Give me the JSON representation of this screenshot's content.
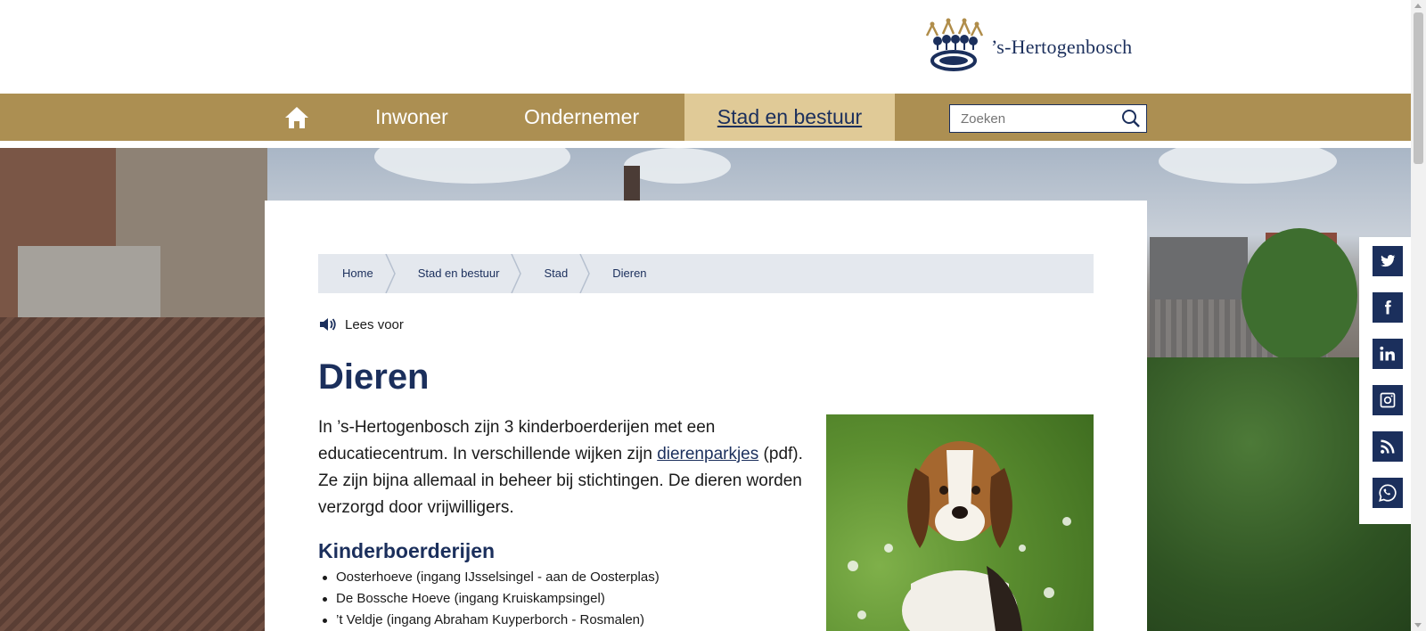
{
  "header": {
    "logo_text": "’s-Hertogenbosch"
  },
  "nav": {
    "home_icon": "home-icon",
    "items": [
      {
        "label": "Inwoner"
      },
      {
        "label": "Ondernemer"
      },
      {
        "label": "Stad en bestuur",
        "active": true
      }
    ],
    "search_placeholder": "Zoeken",
    "accent_color": "#ac8f52",
    "active_color": "#e0ca97"
  },
  "breadcrumb": [
    "Home",
    "Stad en bestuur",
    "Stad",
    "Dieren"
  ],
  "lees_voor": "Lees voor",
  "page": {
    "title": "Dieren",
    "intro_part1": "In ’s-Hertogenbosch zijn 3 kinderboerderijen met een educatiecentrum. In verschillende wijken zijn ",
    "intro_link": "dierenparkjes",
    "intro_part2": " (pdf). Ze zijn bijna allemaal in beheer bij stichtingen. De dieren worden verzorgd door vrijwilligers.",
    "subtitle": "Kinderboerderijen",
    "list": [
      "Oosterhoeve (ingang IJsselsingel - aan de Oosterplas)",
      "De Bossche Hoeve (ingang Kruiskampsingel)",
      "’t Veldje (ingang Abraham Kuyperborch - Rosmalen)"
    ]
  },
  "social": [
    "twitter-icon",
    "facebook-icon",
    "linkedin-icon",
    "instagram-icon",
    "rss-icon",
    "whatsapp-icon"
  ],
  "brand_color": "#1b2f5c"
}
